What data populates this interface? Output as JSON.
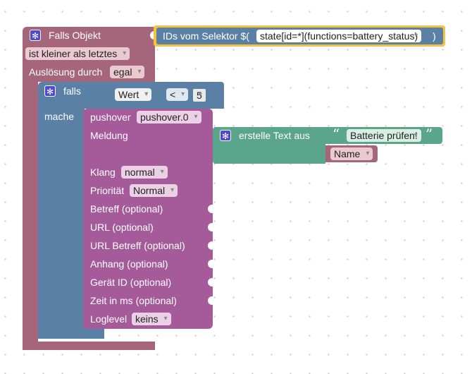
{
  "event_block": {
    "title": "Falls Objekt",
    "compare_option": "ist kleiner als letztes",
    "trigger_label": "Auslösung durch",
    "trigger_option": "egal"
  },
  "selector_block": {
    "label": "IDs vom Selektor $(",
    "value": "state[id=*](functions=battery_status)",
    "close": ")"
  },
  "if_block": {
    "if_label": "falls",
    "do_label": "mache"
  },
  "compare_block": {
    "left": "Wert",
    "operator": "<",
    "right": "5"
  },
  "pushover_block": {
    "label": "pushover",
    "instance": "pushover.0",
    "fields": {
      "message": "Meldung",
      "sound": "Klang",
      "sound_value": "normal",
      "priority": "Priorität",
      "priority_value": "Normal",
      "subject": "Betreff (optional)",
      "url": "URL (optional)",
      "url_subject": "URL Betreff (optional)",
      "attachment": "Anhang (optional)",
      "device_id": "Gerät ID (optional)",
      "time_ms": "Zeit in ms (optional)",
      "loglevel": "Loglevel",
      "loglevel_value": "keins"
    }
  },
  "text_block": {
    "label": "erstelle Text aus",
    "quote_open": "“",
    "text": "Batterie prüfen!",
    "quote_close": "”",
    "variable": "Name"
  },
  "colors": {
    "event": "#a5657a",
    "logic": "#5b80a5",
    "pushover": "#a55b99",
    "text": "#5ba58c",
    "selector_highlight": "#f5c342",
    "selector": "#5b80a5",
    "gear": "#4f48d9"
  }
}
